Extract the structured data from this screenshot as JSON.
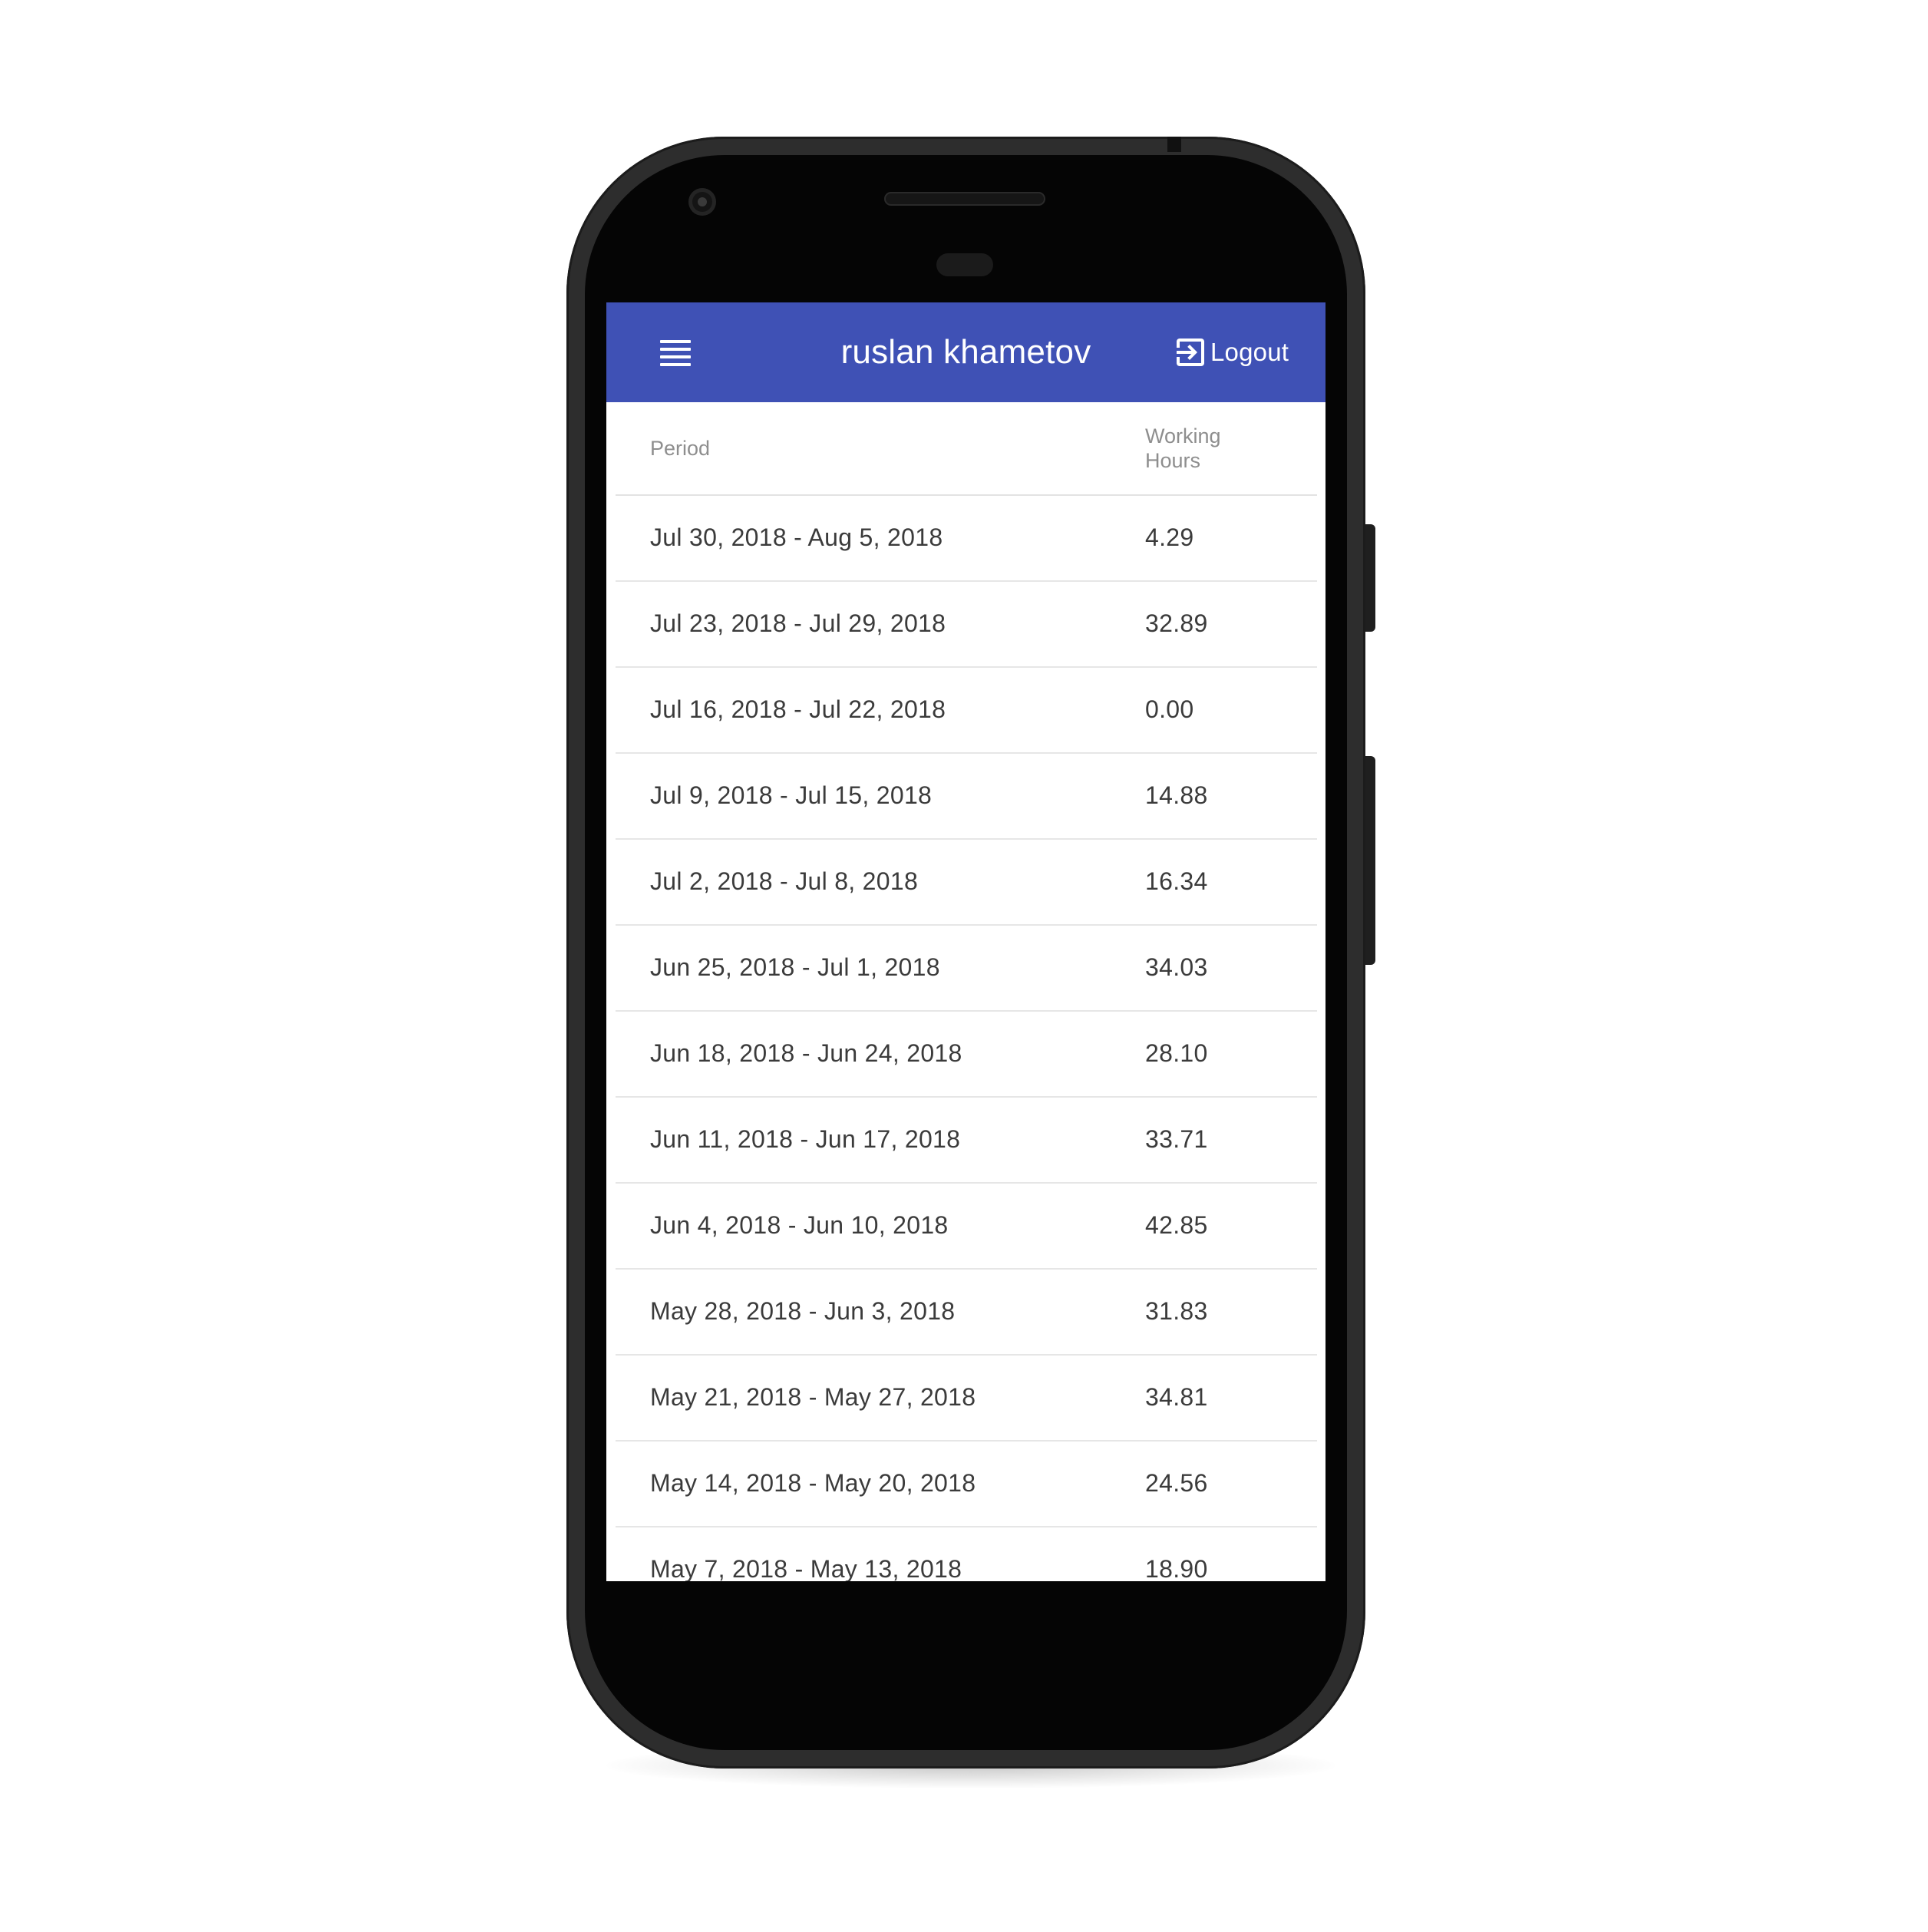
{
  "app_bar": {
    "title": "ruslan khametov",
    "menu_icon": "hamburger-menu-icon",
    "logout_icon": "exit-to-app-icon",
    "logout_label": "Logout",
    "color": "#3f51b5"
  },
  "table": {
    "headers": {
      "period": "Period",
      "working_hours_line1": "Working",
      "working_hours_line2": "Hours"
    },
    "rows": [
      {
        "period": "Jul 30, 2018 - Aug 5, 2018",
        "hours": "4.29"
      },
      {
        "period": "Jul 23, 2018 - Jul 29, 2018",
        "hours": "32.89"
      },
      {
        "period": "Jul 16, 2018 - Jul 22, 2018",
        "hours": "0.00"
      },
      {
        "period": "Jul 9, 2018 - Jul 15, 2018",
        "hours": "14.88"
      },
      {
        "period": "Jul 2, 2018 - Jul 8, 2018",
        "hours": "16.34"
      },
      {
        "period": "Jun 25, 2018 - Jul 1, 2018",
        "hours": "34.03"
      },
      {
        "period": "Jun 18, 2018 - Jun 24, 2018",
        "hours": "28.10"
      },
      {
        "period": "Jun 11, 2018 - Jun 17, 2018",
        "hours": "33.71"
      },
      {
        "period": "Jun 4, 2018 - Jun 10, 2018",
        "hours": "42.85"
      },
      {
        "period": "May 28, 2018 - Jun 3, 2018",
        "hours": "31.83"
      },
      {
        "period": "May 21, 2018 - May 27, 2018",
        "hours": "34.81"
      },
      {
        "period": "May 14, 2018 - May 20, 2018",
        "hours": "24.56"
      },
      {
        "period": "May 7, 2018 - May 13, 2018",
        "hours": "18.90"
      }
    ]
  }
}
